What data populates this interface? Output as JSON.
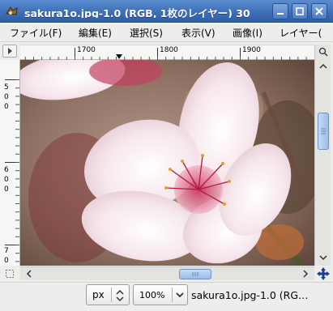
{
  "window": {
    "title": "sakura1o.jpg-1.0 (RGB, 1枚のレイヤー) 30",
    "colors": {
      "titlebar": "#3f6fb7",
      "scroll_thumb": "#9cbce6"
    }
  },
  "menu": [
    "ファイル(F)",
    "編集(E)",
    "選択(S)",
    "表示(V)",
    "画像(I)",
    "レイヤー("
  ],
  "rulers": {
    "horizontal_labels": [
      "1700",
      "1800",
      "1900"
    ],
    "vertical_labels": [
      [
        "5",
        "0",
        "0"
      ],
      [
        "6",
        "0",
        "0"
      ],
      [
        "7",
        "0"
      ]
    ]
  },
  "statusbar": {
    "unit": "px",
    "zoom": "100%",
    "text": "sakura1o.jpg-1.0 (RG…"
  },
  "icons": {
    "app": "wilber-icon",
    "minimize": "minimize-icon",
    "maximize": "maximize-icon",
    "close": "close-icon",
    "quick_mask": "quick-mask-icon",
    "navigate": "navigate-icon",
    "menu_arrow": "menu-arrow-icon",
    "zoom_follow": "zoom-follow-icon"
  }
}
